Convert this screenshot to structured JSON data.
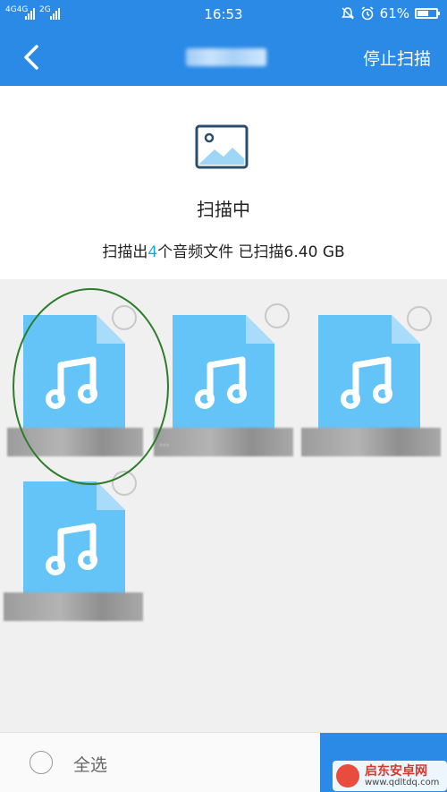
{
  "status_bar": {
    "network": [
      "4G",
      "4G",
      "2G"
    ],
    "time": "16:53",
    "battery": "61%",
    "battery_level": 0.61
  },
  "app_bar": {
    "action_label": "停止扫描"
  },
  "scan": {
    "title": "扫描中",
    "status_prefix": "扫描出",
    "status_count": "4",
    "status_suffix": "个音频文件 已扫描6.40 GB"
  },
  "files": [
    {
      "name": ""
    },
    {
      "name": "..."
    },
    {
      "name": ""
    },
    {
      "name": ""
    }
  ],
  "bottom_bar": {
    "select_all_label": "全选"
  },
  "watermark": {
    "name": "启东安卓网",
    "url": "www.qdltdq.com"
  },
  "colors": {
    "primary": "#2b8ae6",
    "file_icon": "#64c3f7",
    "count_highlight": "#1aa9d6",
    "annotation_circle": "#2e7d2a"
  }
}
